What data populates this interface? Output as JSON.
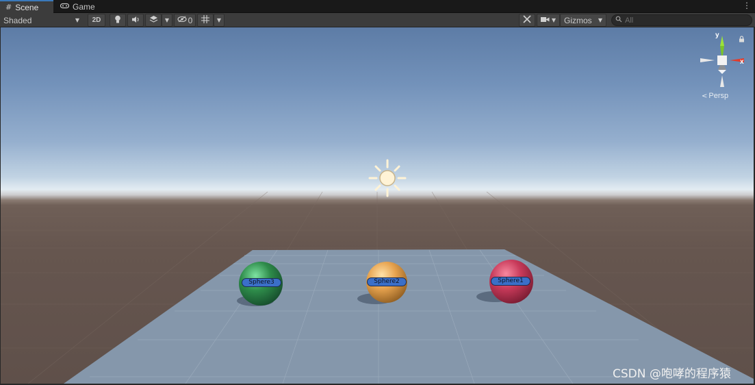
{
  "tabs": [
    {
      "label": "Scene",
      "icon": "hash-grid-icon",
      "active": true
    },
    {
      "label": "Game",
      "icon": "gamepad-icon",
      "active": false
    }
  ],
  "toolbar": {
    "draw_mode": "Shaded",
    "mode_2d": "2D",
    "hidden_count": "0",
    "gizmos_label": "Gizmos",
    "search_placeholder": "All"
  },
  "gizmo": {
    "y_label": "y",
    "x_label": "x",
    "projection": "Persp"
  },
  "scene": {
    "objects": [
      {
        "label": "Sphere3",
        "color": "#2e8b4a"
      },
      {
        "label": "Sphere2",
        "color": "#e6a24e"
      },
      {
        "label": "Sphere1",
        "color": "#c83a5a"
      }
    ],
    "light_icon": "sun-icon"
  },
  "watermark": "CSDN @咆哮的程序猿",
  "colors": {
    "tab_accent": "#3a79bb",
    "editor_bg": "#3c3c3c",
    "label_bg": "#3b6fc8"
  }
}
